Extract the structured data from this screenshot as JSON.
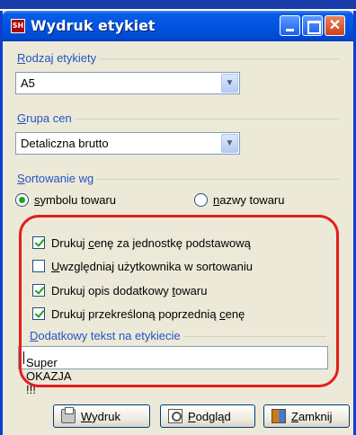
{
  "window": {
    "app_icon_text": "SH",
    "title": "Wydruk etykiet"
  },
  "rodzaj": {
    "label_key": "R",
    "label_rest": "odzaj etykiety",
    "value": "A5"
  },
  "grupa": {
    "label_key": "G",
    "label_rest": "rupa cen",
    "value": "Detaliczna brutto"
  },
  "sortowanie": {
    "label_key": "S",
    "label_rest": "ortowanie wg",
    "options": [
      {
        "label_key": "s",
        "label_rest": "ymbolu towaru",
        "checked": true
      },
      {
        "label_key": "n",
        "label_rest": "azwy towaru",
        "checked": false
      }
    ]
  },
  "checkboxes": [
    {
      "pre": "Drukuj ",
      "key": "c",
      "post": "enę za jednostkę podstawową",
      "checked": true
    },
    {
      "pre": "",
      "key": "U",
      "post": "względniaj użytkownika w sortowaniu",
      "checked": false
    },
    {
      "pre": "Drukuj opis dodatkowy ",
      "key": "t",
      "post": "owaru",
      "checked": true
    },
    {
      "pre": "Drukuj przekreśloną poprzednią ",
      "key": "c",
      "post": "enę",
      "checked": true
    }
  ],
  "dodatkowy": {
    "label_key": "D",
    "label_rest": "odatkowy tekst na etykiecie",
    "value": "Super OKAZJA !!!"
  },
  "buttons": {
    "print": {
      "key": "W",
      "rest": "ydruk"
    },
    "preview": {
      "key": "P",
      "rest": "odgląd"
    },
    "close": {
      "key": "Z",
      "rest": "amknij"
    }
  },
  "colors": {
    "highlight": "#e41d1d",
    "group_label": "#2455c3",
    "check": "#21a121"
  }
}
